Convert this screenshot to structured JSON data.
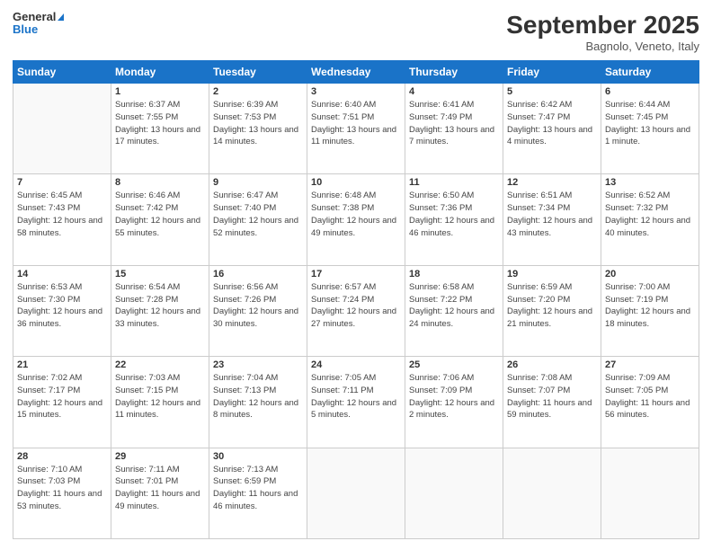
{
  "header": {
    "logo_line1": "General",
    "logo_line2": "Blue",
    "month": "September 2025",
    "location": "Bagnolo, Veneto, Italy"
  },
  "weekdays": [
    "Sunday",
    "Monday",
    "Tuesday",
    "Wednesday",
    "Thursday",
    "Friday",
    "Saturday"
  ],
  "weeks": [
    [
      {
        "day": "",
        "sunrise": "",
        "sunset": "",
        "daylight": ""
      },
      {
        "day": "1",
        "sunrise": "Sunrise: 6:37 AM",
        "sunset": "Sunset: 7:55 PM",
        "daylight": "Daylight: 13 hours and 17 minutes."
      },
      {
        "day": "2",
        "sunrise": "Sunrise: 6:39 AM",
        "sunset": "Sunset: 7:53 PM",
        "daylight": "Daylight: 13 hours and 14 minutes."
      },
      {
        "day": "3",
        "sunrise": "Sunrise: 6:40 AM",
        "sunset": "Sunset: 7:51 PM",
        "daylight": "Daylight: 13 hours and 11 minutes."
      },
      {
        "day": "4",
        "sunrise": "Sunrise: 6:41 AM",
        "sunset": "Sunset: 7:49 PM",
        "daylight": "Daylight: 13 hours and 7 minutes."
      },
      {
        "day": "5",
        "sunrise": "Sunrise: 6:42 AM",
        "sunset": "Sunset: 7:47 PM",
        "daylight": "Daylight: 13 hours and 4 minutes."
      },
      {
        "day": "6",
        "sunrise": "Sunrise: 6:44 AM",
        "sunset": "Sunset: 7:45 PM",
        "daylight": "Daylight: 13 hours and 1 minute."
      }
    ],
    [
      {
        "day": "7",
        "sunrise": "Sunrise: 6:45 AM",
        "sunset": "Sunset: 7:43 PM",
        "daylight": "Daylight: 12 hours and 58 minutes."
      },
      {
        "day": "8",
        "sunrise": "Sunrise: 6:46 AM",
        "sunset": "Sunset: 7:42 PM",
        "daylight": "Daylight: 12 hours and 55 minutes."
      },
      {
        "day": "9",
        "sunrise": "Sunrise: 6:47 AM",
        "sunset": "Sunset: 7:40 PM",
        "daylight": "Daylight: 12 hours and 52 minutes."
      },
      {
        "day": "10",
        "sunrise": "Sunrise: 6:48 AM",
        "sunset": "Sunset: 7:38 PM",
        "daylight": "Daylight: 12 hours and 49 minutes."
      },
      {
        "day": "11",
        "sunrise": "Sunrise: 6:50 AM",
        "sunset": "Sunset: 7:36 PM",
        "daylight": "Daylight: 12 hours and 46 minutes."
      },
      {
        "day": "12",
        "sunrise": "Sunrise: 6:51 AM",
        "sunset": "Sunset: 7:34 PM",
        "daylight": "Daylight: 12 hours and 43 minutes."
      },
      {
        "day": "13",
        "sunrise": "Sunrise: 6:52 AM",
        "sunset": "Sunset: 7:32 PM",
        "daylight": "Daylight: 12 hours and 40 minutes."
      }
    ],
    [
      {
        "day": "14",
        "sunrise": "Sunrise: 6:53 AM",
        "sunset": "Sunset: 7:30 PM",
        "daylight": "Daylight: 12 hours and 36 minutes."
      },
      {
        "day": "15",
        "sunrise": "Sunrise: 6:54 AM",
        "sunset": "Sunset: 7:28 PM",
        "daylight": "Daylight: 12 hours and 33 minutes."
      },
      {
        "day": "16",
        "sunrise": "Sunrise: 6:56 AM",
        "sunset": "Sunset: 7:26 PM",
        "daylight": "Daylight: 12 hours and 30 minutes."
      },
      {
        "day": "17",
        "sunrise": "Sunrise: 6:57 AM",
        "sunset": "Sunset: 7:24 PM",
        "daylight": "Daylight: 12 hours and 27 minutes."
      },
      {
        "day": "18",
        "sunrise": "Sunrise: 6:58 AM",
        "sunset": "Sunset: 7:22 PM",
        "daylight": "Daylight: 12 hours and 24 minutes."
      },
      {
        "day": "19",
        "sunrise": "Sunrise: 6:59 AM",
        "sunset": "Sunset: 7:20 PM",
        "daylight": "Daylight: 12 hours and 21 minutes."
      },
      {
        "day": "20",
        "sunrise": "Sunrise: 7:00 AM",
        "sunset": "Sunset: 7:19 PM",
        "daylight": "Daylight: 12 hours and 18 minutes."
      }
    ],
    [
      {
        "day": "21",
        "sunrise": "Sunrise: 7:02 AM",
        "sunset": "Sunset: 7:17 PM",
        "daylight": "Daylight: 12 hours and 15 minutes."
      },
      {
        "day": "22",
        "sunrise": "Sunrise: 7:03 AM",
        "sunset": "Sunset: 7:15 PM",
        "daylight": "Daylight: 12 hours and 11 minutes."
      },
      {
        "day": "23",
        "sunrise": "Sunrise: 7:04 AM",
        "sunset": "Sunset: 7:13 PM",
        "daylight": "Daylight: 12 hours and 8 minutes."
      },
      {
        "day": "24",
        "sunrise": "Sunrise: 7:05 AM",
        "sunset": "Sunset: 7:11 PM",
        "daylight": "Daylight: 12 hours and 5 minutes."
      },
      {
        "day": "25",
        "sunrise": "Sunrise: 7:06 AM",
        "sunset": "Sunset: 7:09 PM",
        "daylight": "Daylight: 12 hours and 2 minutes."
      },
      {
        "day": "26",
        "sunrise": "Sunrise: 7:08 AM",
        "sunset": "Sunset: 7:07 PM",
        "daylight": "Daylight: 11 hours and 59 minutes."
      },
      {
        "day": "27",
        "sunrise": "Sunrise: 7:09 AM",
        "sunset": "Sunset: 7:05 PM",
        "daylight": "Daylight: 11 hours and 56 minutes."
      }
    ],
    [
      {
        "day": "28",
        "sunrise": "Sunrise: 7:10 AM",
        "sunset": "Sunset: 7:03 PM",
        "daylight": "Daylight: 11 hours and 53 minutes."
      },
      {
        "day": "29",
        "sunrise": "Sunrise: 7:11 AM",
        "sunset": "Sunset: 7:01 PM",
        "daylight": "Daylight: 11 hours and 49 minutes."
      },
      {
        "day": "30",
        "sunrise": "Sunrise: 7:13 AM",
        "sunset": "Sunset: 6:59 PM",
        "daylight": "Daylight: 11 hours and 46 minutes."
      },
      {
        "day": "",
        "sunrise": "",
        "sunset": "",
        "daylight": ""
      },
      {
        "day": "",
        "sunrise": "",
        "sunset": "",
        "daylight": ""
      },
      {
        "day": "",
        "sunrise": "",
        "sunset": "",
        "daylight": ""
      },
      {
        "day": "",
        "sunrise": "",
        "sunset": "",
        "daylight": ""
      }
    ]
  ]
}
